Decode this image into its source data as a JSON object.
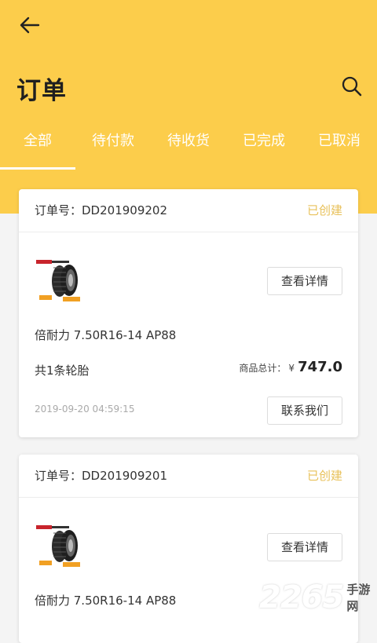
{
  "header": {
    "title": "订单",
    "back_icon": "arrow-left-icon",
    "search_icon": "search-icon"
  },
  "tabs": [
    {
      "label": "全部",
      "active": true
    },
    {
      "label": "待付款",
      "active": false
    },
    {
      "label": "待收货",
      "active": false
    },
    {
      "label": "已完成",
      "active": false
    },
    {
      "label": "已取消",
      "active": false
    }
  ],
  "orders": [
    {
      "order_no": "订单号：DD201909202",
      "status": "已创建",
      "product_name": "倍耐力 7.50R16-14 AP88",
      "detail_button": "查看详情",
      "qty": "共1条轮胎",
      "total_label": "商品总计：",
      "currency": "¥",
      "amount": "747.0",
      "timestamp": "2019-09-20 04:59:15",
      "contact_button": "联系我们"
    },
    {
      "order_no": "订单号：DD201909201",
      "status": "已创建",
      "product_name": "倍耐力 7.50R16-14 AP88",
      "detail_button": "查看详情"
    }
  ],
  "watermark": {
    "number": "2265",
    "text": "手游网"
  },
  "colors": {
    "header_bg": "#fccd4b",
    "status_text": "#e8c15a",
    "page_bg": "#f4f4f4"
  }
}
